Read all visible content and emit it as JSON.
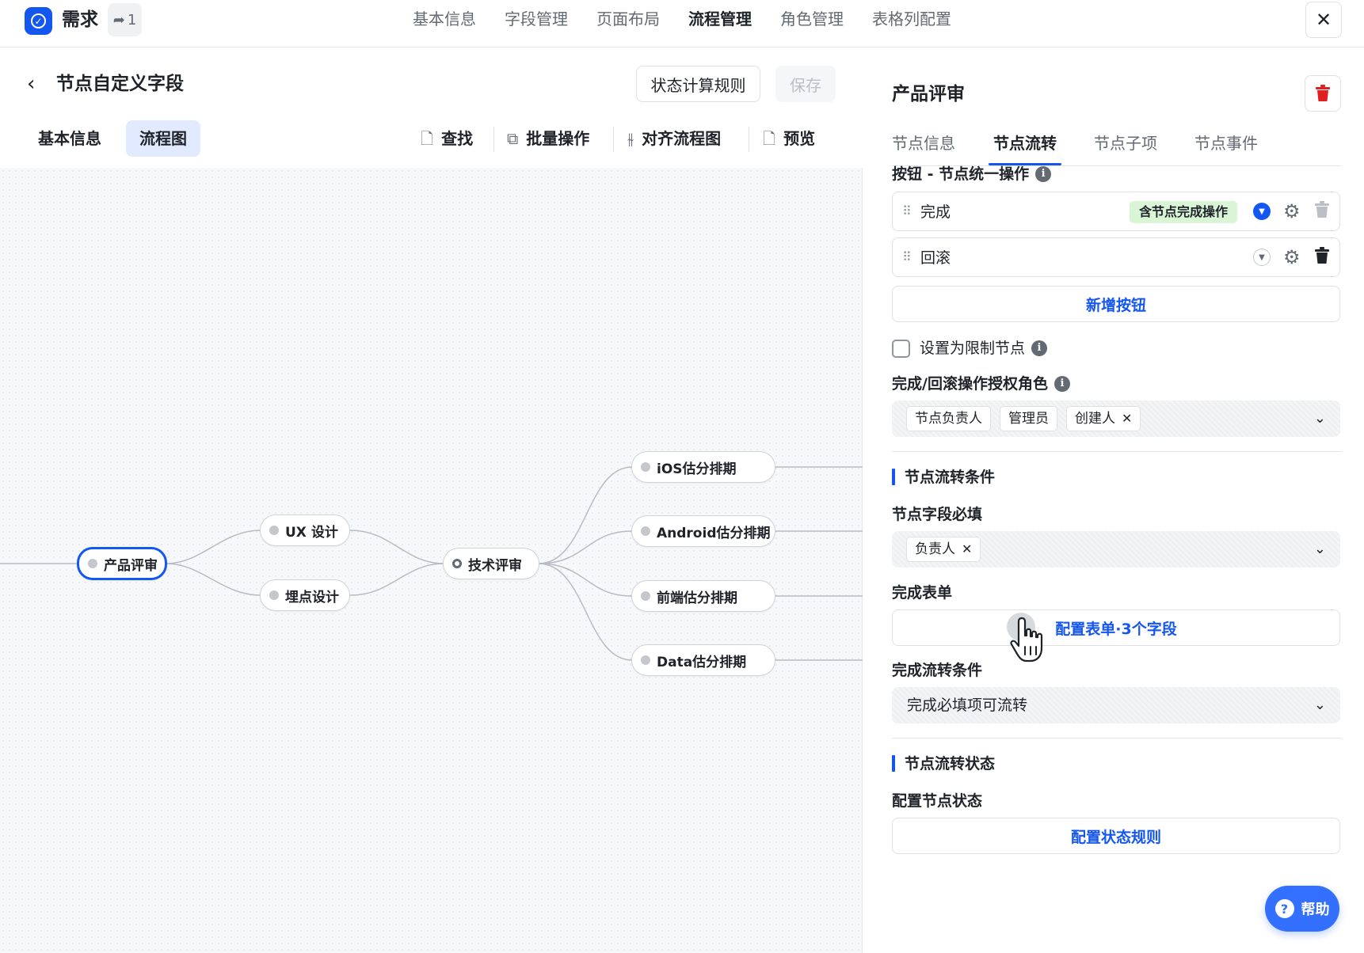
{
  "app": {
    "name": "需求",
    "share_count": "1",
    "logo_icon": "check-circle-icon"
  },
  "top_nav": {
    "items": [
      "基本信息",
      "字段管理",
      "页面布局",
      "流程管理",
      "角色管理",
      "表格列配置"
    ],
    "active": "流程管理"
  },
  "header": {
    "title": "节点自定义字段",
    "state_rule_button": "状态计算规则",
    "save_button": "保存"
  },
  "sub_tabs": [
    "基本信息",
    "流程图"
  ],
  "toolbar": {
    "find": "查找",
    "batch": "批量操作",
    "align": "对齐流程图",
    "preview": "预览"
  },
  "flow": {
    "nodes": [
      "产品评审",
      "UX 设计",
      "埋点设计",
      "技术评审",
      "iOS估分排期",
      "Android估分排期",
      "前端估分排期",
      "Data估分排期"
    ],
    "selected": "产品评审"
  },
  "panel": {
    "title": "产品评审",
    "tabs": [
      "节点信息",
      "节点流转",
      "节点子项",
      "节点事件"
    ],
    "active_tab": "节点流转",
    "buttons_label": "按钮 - 节点统一操作",
    "operations": [
      {
        "name": "完成",
        "tag": "含节点完成操作"
      },
      {
        "name": "回滚"
      }
    ],
    "add_button": "新增按钮",
    "limit_node_label": "设置为限制节点",
    "auth_roles_label": "完成/回滚操作授权角色",
    "auth_roles": [
      "节点负责人",
      "管理员",
      "创建人"
    ],
    "transition_conditions_title": "节点流转条件",
    "required_fields_label": "节点字段必填",
    "required_fields": [
      "负责人"
    ],
    "completion_form_label": "完成表单",
    "completion_form_button": "配置表单·3个字段",
    "completion_condition_label": "完成流转条件",
    "completion_condition_value": "完成必填项可流转",
    "transition_state_title": "节点流转状态",
    "config_state_label": "配置节点状态",
    "config_state_button": "配置状态规则"
  },
  "help": {
    "label": "帮助"
  },
  "colors": {
    "accent": "#1456f0",
    "tag_green": "#d9f5d6",
    "danger": "#e02020"
  }
}
